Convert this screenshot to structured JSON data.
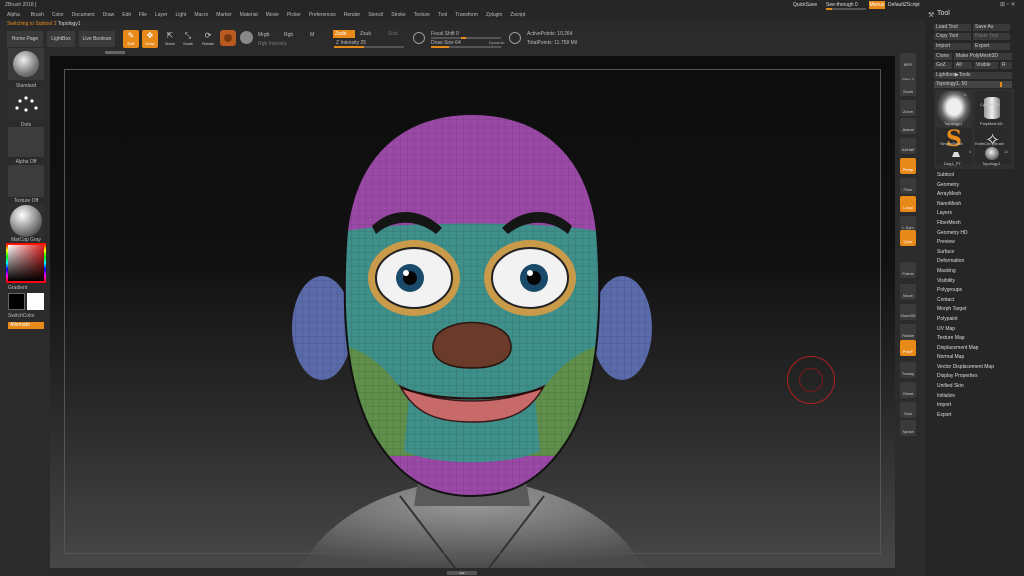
{
  "app": {
    "title": "ZBrush 2018 [",
    "menus": [
      "Alpha",
      "Brush",
      "Color",
      "Document",
      "Draw",
      "Edit",
      "File",
      "Layer",
      "Light",
      "Macro",
      "Marker",
      "Material",
      "Movie",
      "Picker",
      "Preferences",
      "Render",
      "Stencil",
      "Stroke",
      "Texture",
      "Tool",
      "Transform",
      "Zplugin",
      "Zscript"
    ],
    "quicksave": "QuickSave",
    "seethrough": "See-through  0",
    "menus_btn": "Menus",
    "default_zscript": "DefaultZScript",
    "status_prefix": "Switching to Subtool 2",
    "status_tool": "Topology1"
  },
  "shelf": {
    "home_page": "Home Page",
    "lightbox": "LightBox",
    "live_boolean": "Live Boolean",
    "edit": "Edit",
    "draw": "Draw",
    "move": "Move",
    "scale": "Scale",
    "rotate": "Rotate",
    "mrgb": "Mrgb",
    "rgb": "Rgb",
    "m": "M",
    "rgb_intensity": "Rgb Intensity",
    "zadd": "Zadd",
    "zsub": "Zsub",
    "zcut": "Zcut",
    "z_intensity": "Z Intensity 25",
    "z_intensity_value": 25,
    "focal_shift": "Focal Shift 0",
    "focal_shift_value": 0,
    "draw_size": "Draw Size 64",
    "draw_size_value": 64,
    "dynamic": "Dynamic",
    "active_points": "ActivePoints: 10,264",
    "total_points": "TotalPoints: 11.758 Mil"
  },
  "left_tray": {
    "brush_label": "Standard",
    "stroke_label": "Dots",
    "alpha_label": "Alpha Off",
    "texture_label": "Texture Off",
    "material_label": "MatCap Gray",
    "gradient_label": "Gradient",
    "switchcolor_label": "SwitchColor",
    "alternate_label": "Alternate"
  },
  "right_tray": [
    {
      "label": "BPR",
      "on": false
    },
    {
      "label": "SPix 3",
      "on": false
    },
    {
      "label": "Scroll",
      "on": false
    },
    {
      "label": "Zoom",
      "on": false
    },
    {
      "label": "Actual",
      "on": false
    },
    {
      "label": "AAHalf",
      "on": false
    },
    {
      "label": "Persp",
      "on": true
    },
    {
      "label": "Floor",
      "on": false
    },
    {
      "label": "Local",
      "on": true
    },
    {
      "label": "L.Sym",
      "on": false
    },
    {
      "label": "Qxyz",
      "on": true
    },
    {
      "label": "Frame",
      "on": false
    },
    {
      "label": "Move",
      "on": false
    },
    {
      "label": "Zoom3D",
      "on": false
    },
    {
      "label": "Rotate",
      "on": false
    },
    {
      "label": "PolyF",
      "on": true
    },
    {
      "label": "Transp",
      "on": false
    },
    {
      "label": "Ghost",
      "on": false
    },
    {
      "label": "Solo",
      "on": false
    },
    {
      "label": "Xpose",
      "on": false
    }
  ],
  "tool_palette": {
    "title": "Tool",
    "load_tool": "Load Tool",
    "save_as": "Save As",
    "copy_tool": "Copy Tool",
    "paste_tool": "Paste Tool",
    "import": "Import",
    "export": "Export",
    "clone": "Clone",
    "make_polymesh": "Make PolyMesh3D",
    "goz": "GoZ",
    "all": "All",
    "visible": "Visible",
    "r": "R",
    "lightbox_tools": "Lightbox▶Tools",
    "topology_slider": "Topology1. 50",
    "topology_value": 50,
    "thumbs": [
      {
        "label": "Topology1",
        "count": "11"
      },
      {
        "label": "Cylinder3D",
        "count": ""
      },
      {
        "label": "PolyMesh3D",
        "count": ""
      },
      {
        "label": "SimpleBrush",
        "count": ""
      },
      {
        "label": "KnifeCirc_Brush",
        "count": ""
      },
      {
        "label": "Dog1_PT",
        "count": "4"
      },
      {
        "label": "Topology1",
        "count": "11"
      }
    ],
    "subpalettes": [
      "Subtool",
      "Geometry",
      "ArrayMesh",
      "NanoMesh",
      "Layers",
      "FiberMesh",
      "Geometry HD",
      "Preview",
      "Surface",
      "Deformation",
      "Masking",
      "Visibility",
      "Polygroups",
      "Contact",
      "Morph Target",
      "Polypaint",
      "UV Map",
      "Texture Map",
      "Displacement Map",
      "Normal Map",
      "Vector Displacement Map",
      "Display Properties",
      "Unified Skin",
      "Initialize",
      "Import",
      "Export"
    ]
  },
  "colors": {
    "accent": "#e88a1a",
    "head_top": "#9a4aa6",
    "face_mid": "#3f8f8a",
    "cheek": "#5f8f4a",
    "ears": "#5a6aaa",
    "nose": "#6a3a2a",
    "lips": "#c86a6a",
    "eyelid": "#c89a4a",
    "iris": "#1a4a6a"
  }
}
